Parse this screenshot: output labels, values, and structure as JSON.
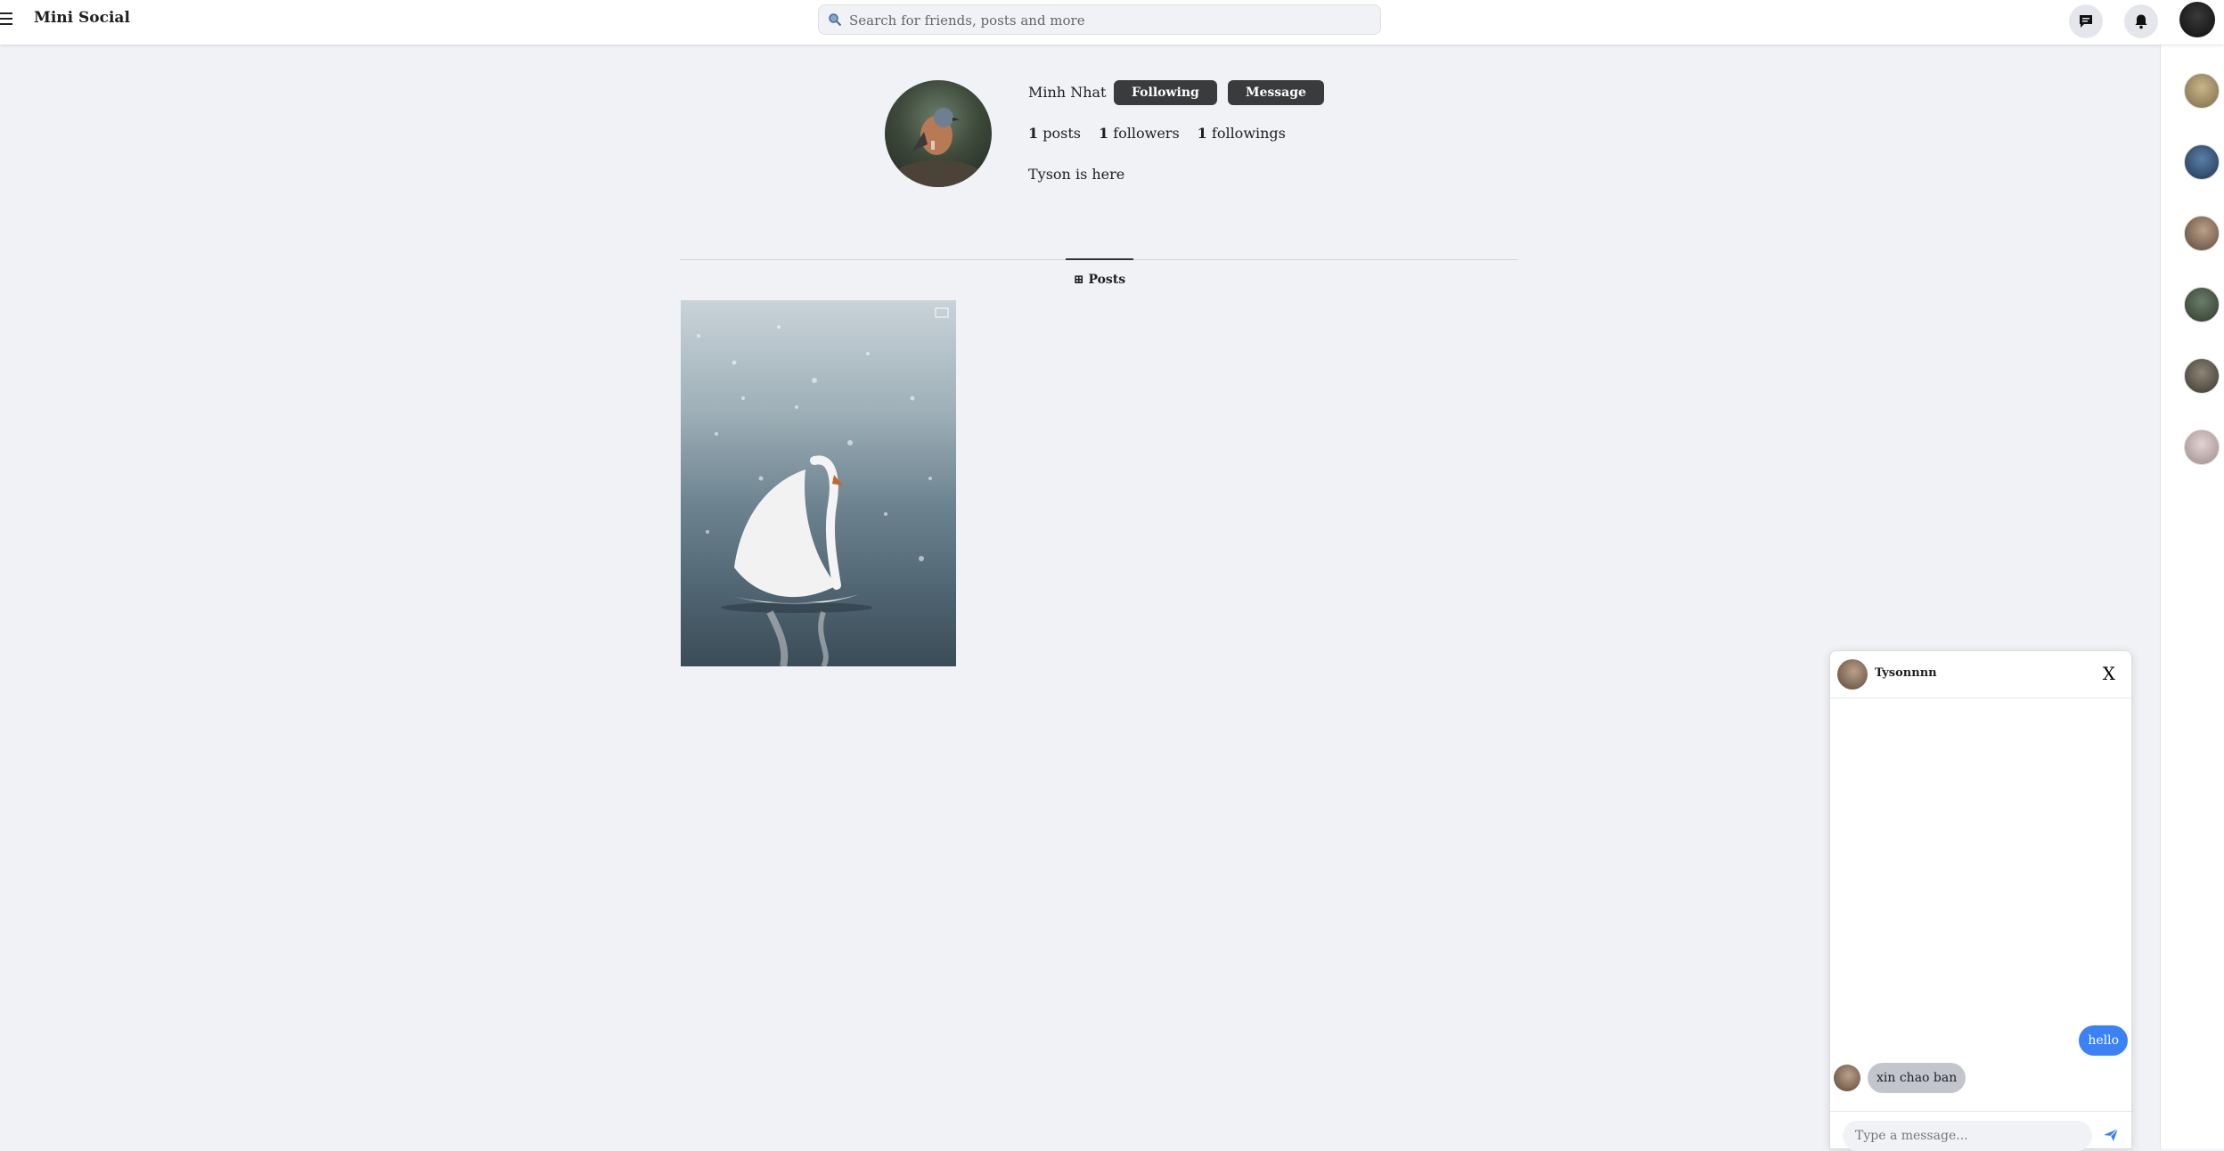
{
  "app": {
    "brand": "Mini Social"
  },
  "search": {
    "placeholder": "Search for friends, posts and more"
  },
  "profile": {
    "name": "Minh Nhat",
    "following_label": "Following",
    "message_label": "Message",
    "stats": {
      "posts_count": "1",
      "posts_label": "posts",
      "followers_count": "1",
      "followers_label": "followers",
      "followings_count": "1",
      "followings_label": "followings"
    },
    "bio": "Tyson is here"
  },
  "tabs": {
    "posts_label": "Posts"
  },
  "chat": {
    "name": "Tysonnnn",
    "close_label": "X",
    "messages": [
      {
        "from": "me",
        "text": "hello"
      },
      {
        "from": "them",
        "text": "xin chao ban"
      }
    ],
    "input_placeholder": "Type a message..."
  },
  "colors": {
    "accent": "#3b82f6",
    "button_dark": "#3a3b3c",
    "background": "#f0f2f5"
  }
}
